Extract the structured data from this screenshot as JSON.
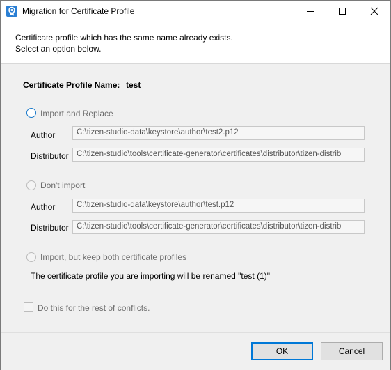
{
  "window": {
    "title": "Migration for Certificate Profile"
  },
  "header": {
    "line1": "Certificate profile which has the same name already exists.",
    "line2": "Select an option below."
  },
  "profile": {
    "name_label": "Certificate Profile Name:",
    "name_value": "test"
  },
  "options": [
    {
      "label": "Import and Replace",
      "selected": false,
      "author_label": "Author",
      "author_value": "C:\\tizen-studio-data\\keystore\\author\\test2.p12",
      "distributor_label": "Distributor",
      "distributor_value": "C:\\tizen-studio\\tools\\certificate-generator\\certificates\\distributor\\tizen-distrib"
    },
    {
      "label": "Don't import",
      "selected": false,
      "author_label": "Author",
      "author_value": "C:\\tizen-studio-data\\keystore\\author\\test.p12",
      "distributor_label": "Distributor",
      "distributor_value": "C:\\tizen-studio\\tools\\certificate-generator\\certificates\\distributor\\tizen-distrib"
    },
    {
      "label": "Import, but keep both certificate profiles",
      "selected": false,
      "note": "The certificate profile you are importing will be renamed \"test (1)\""
    }
  ],
  "checkbox": {
    "label": "Do this for the rest of conflicts.",
    "checked": false
  },
  "buttons": {
    "ok": "OK",
    "cancel": "Cancel"
  },
  "colors": {
    "accent": "#0078d7",
    "body_bg": "#f0f0f0"
  }
}
